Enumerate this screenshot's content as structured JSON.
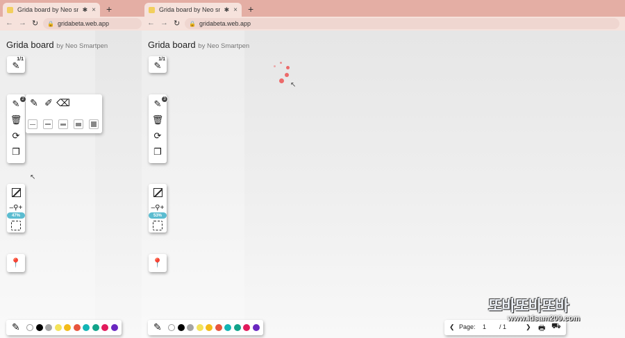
{
  "browser": {
    "tab_title": "Grida board by Neo smartp",
    "address": "gridabeta.web.app",
    "new_tab": "+",
    "close": "×",
    "bluetooth_glyph": "✱",
    "back": "←",
    "forward": "→",
    "reload": "↻",
    "lock": "🔒"
  },
  "app": {
    "title": "Grida board",
    "subtitle": "by Neo Smartpen"
  },
  "left": {
    "page_indicator": "1/1",
    "pen_count": "2",
    "zoom": "47%"
  },
  "right": {
    "page_indicator": "1/1",
    "pen_count": "3",
    "zoom": "53%"
  },
  "pen_popup": {
    "pen_types": [
      "pen",
      "marker",
      "eraser"
    ],
    "thickness_levels": [
      1,
      2,
      3,
      4,
      5
    ]
  },
  "palette": {
    "left_colors": [
      "#ffffff",
      "#000000",
      "#a5a5a5",
      "#f4e35a",
      "#f3bb1b",
      "#e8553e",
      "#13b5b5",
      "#12a38a",
      "#e21b5c",
      "#6a27c0"
    ],
    "right_colors": [
      "#ffffff",
      "#000000",
      "#a5a5a5",
      "#f4e35a",
      "#f3bb1b",
      "#e8553e",
      "#13b5b5",
      "#12a38a",
      "#e21b5c",
      "#6a27c0"
    ]
  },
  "pagination": {
    "label": "Page:",
    "current": "1",
    "total": "/ 1",
    "prev": "❮",
    "next": "❯"
  },
  "watermark": {
    "text": "또바또바또바",
    "url": "www.idsam209.com"
  },
  "colors": {
    "tab_strip": "#e4aea4",
    "address_bar": "#f6e2dc",
    "zoom_badge": "#5bbcd0",
    "loading_spinner": "#ec6a6a"
  }
}
